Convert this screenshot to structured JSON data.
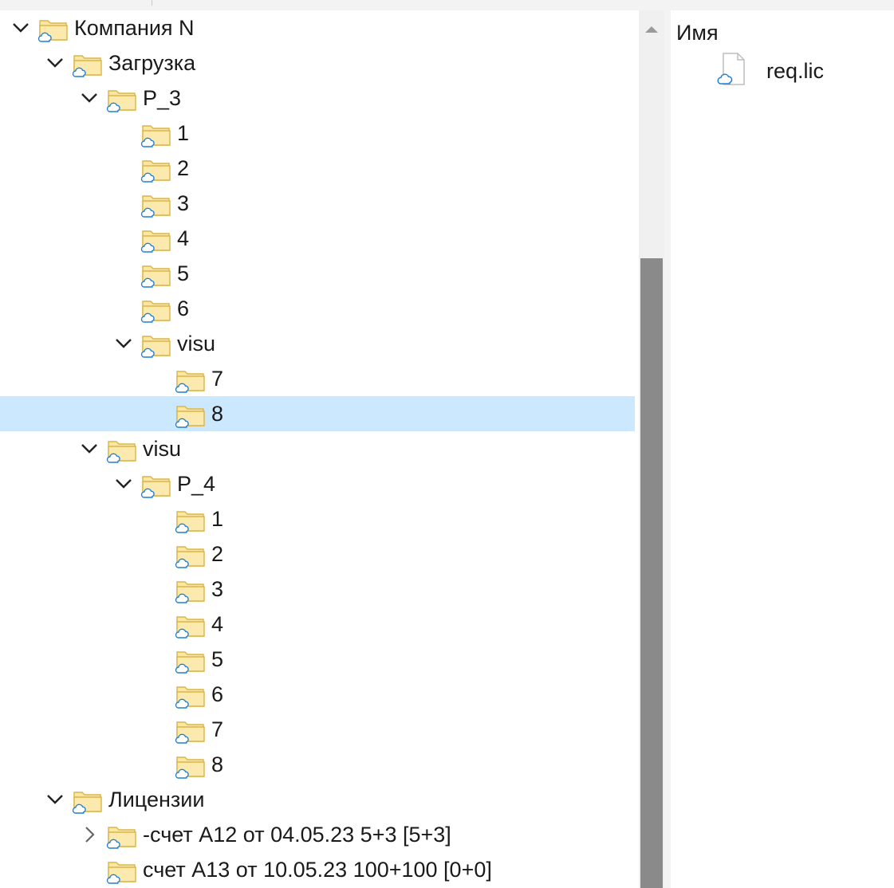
{
  "tree": {
    "nodes": [
      {
        "label": "Компания N",
        "depth": 0,
        "expander": "open",
        "selected": false,
        "icon": "cloud-folder-icon"
      },
      {
        "label": "Загрузка",
        "depth": 1,
        "expander": "open",
        "selected": false,
        "icon": "cloud-folder-icon"
      },
      {
        "label": "P_3",
        "depth": 2,
        "expander": "open",
        "selected": false,
        "icon": "cloud-folder-icon"
      },
      {
        "label": "1",
        "depth": 3,
        "expander": "none",
        "selected": false,
        "icon": "cloud-folder-icon"
      },
      {
        "label": "2",
        "depth": 3,
        "expander": "none",
        "selected": false,
        "icon": "cloud-folder-icon"
      },
      {
        "label": "3",
        "depth": 3,
        "expander": "none",
        "selected": false,
        "icon": "cloud-folder-icon"
      },
      {
        "label": "4",
        "depth": 3,
        "expander": "none",
        "selected": false,
        "icon": "cloud-folder-icon"
      },
      {
        "label": "5",
        "depth": 3,
        "expander": "none",
        "selected": false,
        "icon": "cloud-folder-icon"
      },
      {
        "label": "6",
        "depth": 3,
        "expander": "none",
        "selected": false,
        "icon": "cloud-folder-icon"
      },
      {
        "label": "visu",
        "depth": 3,
        "expander": "open",
        "selected": false,
        "icon": "cloud-folder-icon"
      },
      {
        "label": "7",
        "depth": 4,
        "expander": "none",
        "selected": false,
        "icon": "cloud-folder-icon"
      },
      {
        "label": "8",
        "depth": 4,
        "expander": "none",
        "selected": true,
        "icon": "cloud-folder-icon"
      },
      {
        "label": "visu",
        "depth": 2,
        "expander": "open",
        "selected": false,
        "icon": "cloud-folder-icon"
      },
      {
        "label": "P_4",
        "depth": 3,
        "expander": "open",
        "selected": false,
        "icon": "cloud-folder-icon"
      },
      {
        "label": "1",
        "depth": 4,
        "expander": "none",
        "selected": false,
        "icon": "cloud-folder-icon"
      },
      {
        "label": "2",
        "depth": 4,
        "expander": "none",
        "selected": false,
        "icon": "cloud-folder-icon"
      },
      {
        "label": "3",
        "depth": 4,
        "expander": "none",
        "selected": false,
        "icon": "cloud-folder-icon"
      },
      {
        "label": "4",
        "depth": 4,
        "expander": "none",
        "selected": false,
        "icon": "cloud-folder-icon"
      },
      {
        "label": "5",
        "depth": 4,
        "expander": "none",
        "selected": false,
        "icon": "cloud-folder-icon"
      },
      {
        "label": "6",
        "depth": 4,
        "expander": "none",
        "selected": false,
        "icon": "cloud-folder-icon"
      },
      {
        "label": "7",
        "depth": 4,
        "expander": "none",
        "selected": false,
        "icon": "cloud-folder-icon"
      },
      {
        "label": "8",
        "depth": 4,
        "expander": "none",
        "selected": false,
        "icon": "cloud-folder-icon"
      },
      {
        "label": "Лицензии",
        "depth": 1,
        "expander": "open",
        "selected": false,
        "icon": "cloud-folder-icon"
      },
      {
        "label": "-счет А12 от 04.05.23 5+3 [5+3]",
        "depth": 2,
        "expander": "closed",
        "selected": false,
        "icon": "cloud-folder-icon"
      },
      {
        "label": "счет А13 от 10.05.23 100+100 [0+0]",
        "depth": 2,
        "expander": "none",
        "selected": false,
        "icon": "cloud-folder-icon"
      }
    ]
  },
  "scrollbar": {
    "up_arrow_icon": "scroll-up-arrow-icon",
    "position_fraction": 0.28
  },
  "file_list": {
    "column_header": "Имя",
    "items": [
      {
        "name": "req.lic",
        "icon": "cloud-file-icon"
      }
    ]
  },
  "colors": {
    "selection": "#cce8ff",
    "folder_fill": "#fbe6a2",
    "folder_stroke": "#d9b54a",
    "cloud_stroke": "#1f7fd6",
    "scroll_thumb": "#8a8a8a"
  }
}
